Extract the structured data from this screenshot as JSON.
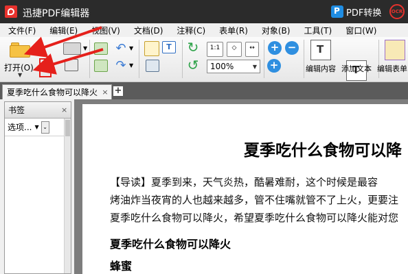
{
  "titlebar": {
    "app_title": "迅捷PDF编辑器",
    "pdf_convert_label": "PDF转换",
    "ocr_label": "OCR"
  },
  "menu": [
    "文件(F)",
    "编辑(E)",
    "视图(V)",
    "文档(D)",
    "注释(C)",
    "表单(R)",
    "对象(B)",
    "工具(T)",
    "窗口(W)"
  ],
  "toolbar": {
    "open_label": "打开(O)...",
    "zoom_value": "100%",
    "edit_content_label": "编辑内容",
    "add_text_label": "添加文本",
    "edit_form_label": "编辑表单"
  },
  "tabs": {
    "doc_tab": "夏季吃什么食物可以降火",
    "add": "+",
    "close": "×"
  },
  "sidebar": {
    "title": "书签",
    "options_label": "选项..."
  },
  "document": {
    "title": "夏季吃什么食物可以降",
    "paragraph_lines": [
      "【导读】夏季到来，天气炎热，酷暑难耐，这个时候是最容",
      "烤油炸当夜宵的人也越来越多，管不住嘴就管不了上火，更要注",
      "夏季吃什么食物可以降火，希望夏季吃什么食物可以降火能对您"
    ],
    "heading1": "夏季吃什么食物可以降火",
    "heading2": "蜂蜜"
  },
  "colors": {
    "titlebar_bg": "#2b2b2b",
    "annotation_red": "#e5201b",
    "accent_blue": "#2f8fe0"
  }
}
